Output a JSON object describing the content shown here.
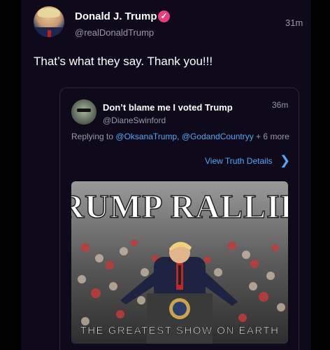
{
  "post": {
    "author_name": "Donald J. Trump",
    "author_handle": "@realDonaldTrump",
    "time": "31m",
    "text": "That’s what they say. Thank you!!!",
    "verified_icon": "verified-badge-icon"
  },
  "quoted_post": {
    "author_name": "Don’t blame me I voted Trump",
    "author_handle": "@DianeSwinford",
    "time": "36m",
    "replying_prefix": "Replying to",
    "replying_user_1": "@OksanaTrump",
    "replying_separator": ",",
    "replying_user_2": "@GodandCountryy",
    "replying_suffix": "+ 6 more",
    "details_label": "View Truth Details",
    "details_icon": "chevron-right-icon"
  },
  "media": {
    "headline": "TRUMP RALLIES",
    "tagline": "THE GREATEST SHOW ON EARTH"
  },
  "colors": {
    "background": "#0e0a1c",
    "accent_link": "#58a6ef",
    "verified": "#e83d7c",
    "muted_text": "#9a97ad"
  }
}
